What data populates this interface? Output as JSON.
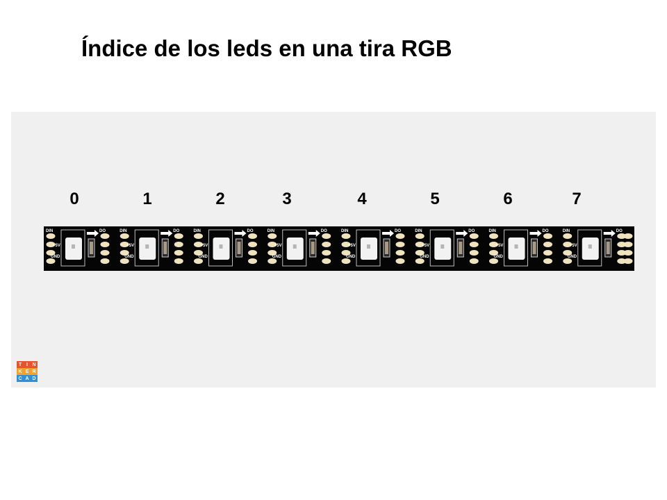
{
  "title": "Índice de los leds en una tira RGB",
  "led_indices": [
    "0",
    "1",
    "2",
    "3",
    "4",
    "5",
    "6",
    "7"
  ],
  "pad_labels": {
    "din": "DIN",
    "dout": "DO",
    "vcc": "+5V",
    "gnd": "GND"
  },
  "colors": {
    "canvas_background": "#f0f0f1",
    "strip_board": "#050505",
    "pad": "#efe3bf",
    "led_package": "#f2f2f2"
  },
  "logo": {
    "letters": [
      "T",
      "I",
      "N",
      "K",
      "E",
      "R",
      "C",
      "A",
      "D"
    ],
    "colors": [
      "#e8522d",
      "#e8522d",
      "#e8522d",
      "#f2a12c",
      "#f2a12c",
      "#f2a12c",
      "#2f8fd8",
      "#2f8fd8",
      "#2f8fd8"
    ]
  }
}
